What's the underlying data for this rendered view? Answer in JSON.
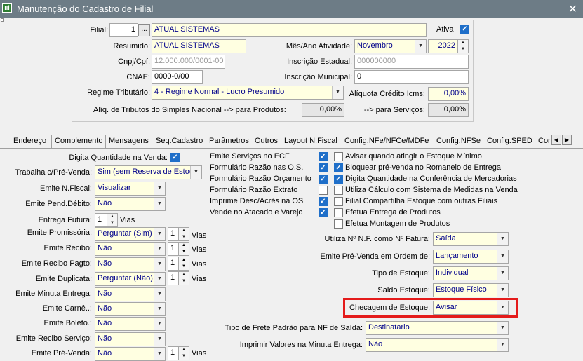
{
  "window": {
    "title": "Manutenção do Cadastro de Filial"
  },
  "header": {
    "filial_label": "Filial:",
    "filial_code": "1",
    "filial_browse": "...",
    "filial_name": "ATUAL SISTEMAS",
    "ativa_label": "Ativa",
    "ativa_checked": true,
    "resumido_label": "Resumido:",
    "resumido_value": "ATUAL SISTEMAS",
    "mes_ano_label": "Mês/Ano Atividade:",
    "mes_value": "Novembro",
    "ano_value": "2022",
    "cnpj_label": "Cnpj/Cpf:",
    "cnpj_value": "12.000.000/0001-00",
    "ie_label": "Inscrição Estadual:",
    "ie_value": "000000000",
    "cnae_label": "CNAE:",
    "cnae_value": "0000-0/00",
    "im_label": "Inscrição Municipal:",
    "im_value": "0",
    "regime_label": "Regime Tributário:",
    "regime_value": "4 - Regime Normal - Lucro Presumido",
    "aliq_icms_label": "Alíquota Crédito Icms:",
    "aliq_icms_value": "0,00%",
    "simples_label": "Alíq. de Tributos do Simples Nacional  --> para Produtos:",
    "simples_prod_value": "0,00%",
    "servicos_label": "--> para Serviços:",
    "servicos_value": "0,00%"
  },
  "tabs": [
    "Endereço",
    "Complemento",
    "Mensagens",
    "Seq.Cadastro",
    "Parâmetros",
    "Outros",
    "Layout N.Fiscal",
    "Config.NFe/NFCe/MDFe",
    "Config.NFSe",
    "Config.SPED",
    "Cor"
  ],
  "left": {
    "digita_qtd_label": "Digita Quantidade na Venda:",
    "trabalha_prevenda_label": "Trabalha c/Pré-Venda:",
    "trabalha_prevenda_value": "Sim (sem Reserva de Estoc",
    "emite_nfiscal_label": "Emite N.Fiscal:",
    "emite_nfiscal_value": "Visualizar",
    "emite_pend_label": "Emite Pend.Débito:",
    "emite_pend_value": "Não",
    "entrega_futura_label": "Entrega Futura:",
    "entrega_futura_value": "1",
    "vias": "Vias",
    "promissoria_label": "Emite Promissória:",
    "promissoria_value": "Perguntar (Sim)",
    "promissoria_vias": "1",
    "recibo_label": "Emite Recibo:",
    "recibo_value": "Não",
    "recibo_vias": "1",
    "recibo_pagto_label": "Emite Recibo Pagto:",
    "recibo_pagto_value": "Não",
    "recibo_pagto_vias": "1",
    "duplicata_label": "Emite Duplicata:",
    "duplicata_value": "Perguntar (Não)",
    "duplicata_vias": "1",
    "minuta_label": "Emite Minuta Entrega:",
    "minuta_value": "Não",
    "carne_label": "Emite Carnê..:",
    "carne_value": "Não",
    "boleto_label": "Emite Boleto.:",
    "boleto_value": "Não",
    "recibo_servico_label": "Emite Recibo Serviço:",
    "recibo_servico_value": "Não",
    "prevenda_label": "Emite Pré-Venda:",
    "prevenda_value": "Não",
    "prevenda_vias": "1"
  },
  "middle": {
    "emite_ecf": "Emite Serviços no ECF",
    "form_os": "Formulário Razão nas O.S.",
    "form_orc": "Formulário Razão Orçamento",
    "form_extrato": "Formulário Razão Extrato",
    "imprime_desc": "Imprime Desc/Acrés na OS",
    "vende_atacado": "Vende no Atacado e Varejo"
  },
  "right": {
    "avisar_min": "Avisar quando atingir o Estoque Mínimo",
    "bloquear_prevenda": "Bloquear pré-venda no Romaneio de Entrega",
    "digita_conferencia": "Digita Quantidade na Conferência de Mercadorias",
    "utiliza_calculo": "Utiliza Cálculo com Sistema de Medidas na Venda",
    "filial_compartilha": "Filial Compartilha Estoque com outras Filiais",
    "efetua_entrega": "Efetua Entrega de Produtos",
    "efetua_montagem": "Efetua Montagem de Produtos"
  },
  "lower": {
    "utiliza_nf_label": "Utiliza Nº N.F. como Nº Fatura:",
    "utiliza_nf_value": "Saída",
    "ordem_prevenda_label": "Emite Pré-Venda em Ordem de:",
    "ordem_prevenda_value": "Lançamento",
    "tipo_estoque_label": "Tipo de Estoque:",
    "tipo_estoque_value": "Individual",
    "saldo_estoque_label": "Saldo Estoque:",
    "saldo_estoque_value": "Estoque Físico",
    "checagem_label": "Checagem de Estoque:",
    "checagem_value": "Avisar",
    "frete_label": "Tipo de Frete Padrão para NF de Saída:",
    "frete_value": "Destinatario",
    "imprimir_valores_label": "Imprimir Valores na Minuta Entrega:",
    "imprimir_valores_value": "Não"
  },
  "colors": {
    "titlebar": "#6d7c86",
    "highlight": "#e41b1b",
    "field_yellow": "#ffffe1",
    "check_blue": "#1f6fc9"
  }
}
